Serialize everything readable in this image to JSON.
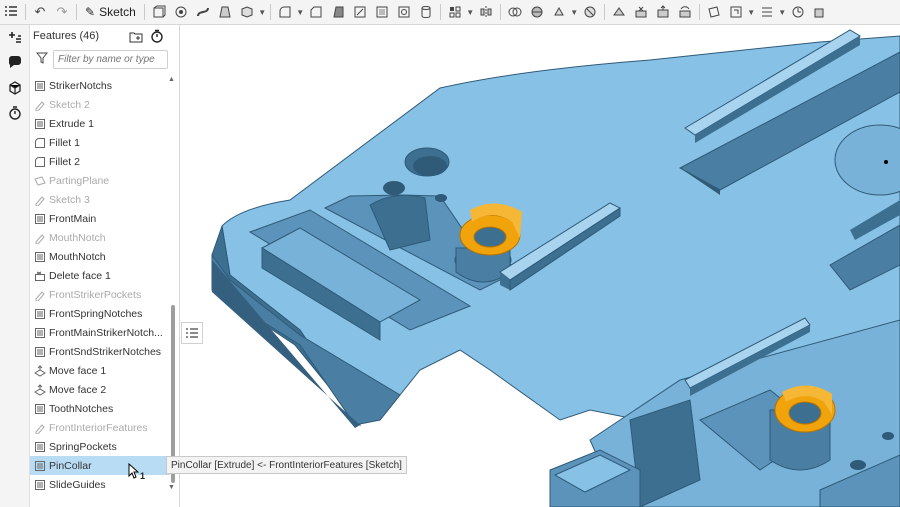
{
  "toolbar": {
    "sketch_label": "Sketch"
  },
  "features": {
    "header": "Features (46)",
    "filter_placeholder": "Filter by name or type",
    "items": [
      {
        "label": "StrikerNotchs",
        "type": "sketch-plane",
        "suppressed": false
      },
      {
        "label": "Sketch 2",
        "type": "sketch",
        "suppressed": true
      },
      {
        "label": "Extrude 1",
        "type": "extrude",
        "suppressed": false
      },
      {
        "label": "Fillet 1",
        "type": "fillet",
        "suppressed": false
      },
      {
        "label": "Fillet 2",
        "type": "fillet",
        "suppressed": false
      },
      {
        "label": "PartingPlane",
        "type": "plane",
        "suppressed": true
      },
      {
        "label": "Sketch 3",
        "type": "sketch",
        "suppressed": true
      },
      {
        "label": "FrontMain",
        "type": "extrude",
        "suppressed": false
      },
      {
        "label": "MouthNotch",
        "type": "sketch",
        "suppressed": true
      },
      {
        "label": "MouthNotch",
        "type": "extrude",
        "suppressed": false
      },
      {
        "label": "Delete face 1",
        "type": "delete-face",
        "suppressed": false
      },
      {
        "label": "FrontStrikerPockets",
        "type": "sketch",
        "suppressed": true
      },
      {
        "label": "FrontSpringNotches",
        "type": "extrude",
        "suppressed": false
      },
      {
        "label": "FrontMainStrikerNotch...",
        "type": "extrude",
        "suppressed": false
      },
      {
        "label": "FrontSndStrikerNotches",
        "type": "extrude",
        "suppressed": false
      },
      {
        "label": "Move face 1",
        "type": "move-face",
        "suppressed": false
      },
      {
        "label": "Move face 2",
        "type": "move-face",
        "suppressed": false
      },
      {
        "label": "ToothNotches",
        "type": "extrude",
        "suppressed": false
      },
      {
        "label": "FrontInteriorFeatures",
        "type": "sketch",
        "suppressed": true
      },
      {
        "label": "SpringPockets",
        "type": "extrude",
        "suppressed": false
      },
      {
        "label": "PinCollar",
        "type": "extrude",
        "suppressed": false,
        "selected": true
      },
      {
        "label": "SlideGuides",
        "type": "extrude",
        "suppressed": false
      }
    ]
  },
  "tooltip": {
    "text": "PinCollar [Extrude] <- FrontInteriorFeatures [Sketch]"
  },
  "cursor": {
    "count": "1"
  },
  "colors": {
    "part_face": "#87c2e6",
    "part_side": "#3d6f91",
    "part_dark": "#2f5a78",
    "highlight": "#f0a30a",
    "selection": "#b9dcf5"
  }
}
